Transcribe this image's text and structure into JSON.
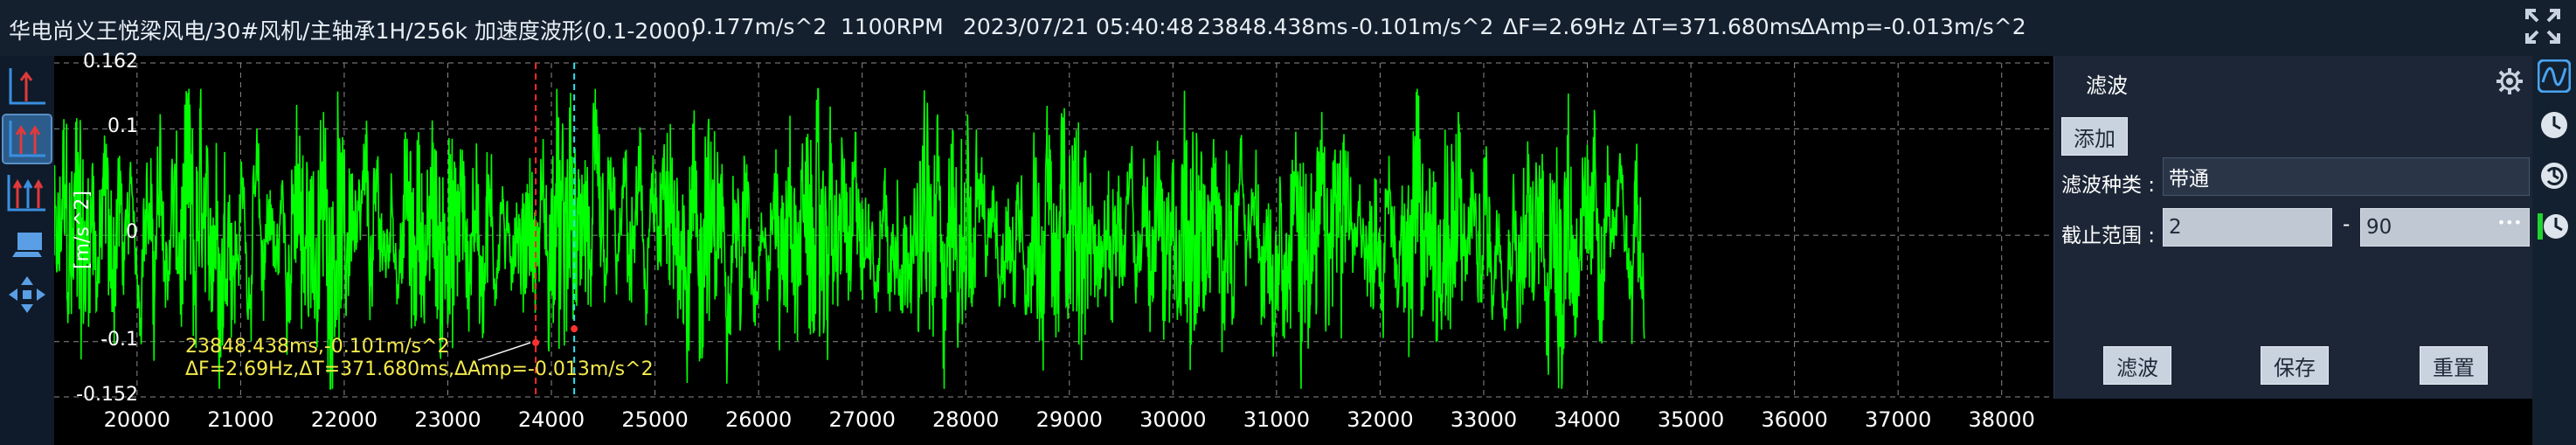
{
  "header": {
    "path": "华电尚义王悦梁风电/30#风机/主轴承1H/256k 加速度波形(0.1-2000)",
    "rms": "0.177m/s^2",
    "speed": "1100RPM",
    "datetime": "2023/07/21 05:40:48",
    "cursor_time": "23848.438ms",
    "cursor_amp": "-0.101m/s^2",
    "delta_f": "ΔF=2.69Hz",
    "delta_t": "ΔT=371.680ms",
    "delta_amp": "ΔAmp=-0.013m/s^2",
    "expand_icon": "expand-icon"
  },
  "toolbar": {
    "items": [
      {
        "icon": "single-cursor-icon"
      },
      {
        "icon": "double-cursor-icon"
      },
      {
        "icon": "multi-cursor-icon"
      },
      {
        "icon": "screenshot-icon"
      },
      {
        "icon": "move-icon"
      }
    ]
  },
  "chart_data": {
    "type": "line",
    "title": "",
    "xlabel": "",
    "ylabel": "[m/s^2]",
    "xlim": [
      19200,
      38500
    ],
    "ylim": [
      -0.152,
      0.162
    ],
    "y_ticks": [
      "0.162",
      "0.1",
      "0",
      "-0.1",
      "-0.152"
    ],
    "x_ticks": [
      "20000",
      "21000",
      "22000",
      "23000",
      "24000",
      "25000",
      "26000",
      "27000",
      "28000",
      "29000",
      "30000",
      "31000",
      "32000",
      "33000",
      "34000",
      "35000",
      "36000",
      "37000",
      "38000"
    ],
    "series": [
      {
        "color": "#00ff00",
        "plotted_range_ms": [
          19200,
          34550
        ]
      }
    ],
    "cursors": [
      {
        "x": 23848.438,
        "y": -0.101,
        "color": "#ff2a2a"
      },
      {
        "x": 24220.118,
        "y": -0.088,
        "color": "#29e3f0"
      }
    ],
    "cursor_label_line1": "23848.438ms,-0.101m/s^2",
    "cursor_label_line2": "ΔF=2.69Hz,ΔT=371.680ms,ΔAmp=-0.013m/s^2",
    "grid": true
  },
  "filter_panel": {
    "title": "滤波",
    "add_label": "添加",
    "type_label": "滤波种类 :",
    "type_value": "带通",
    "range_label": "截止范围 :",
    "range_low": "2",
    "range_sep": "-",
    "range_high": "90",
    "more_glyph": "•••",
    "apply_label": "滤波",
    "save_label": "保存",
    "reset_label": "重置",
    "gear_icon": "gear-icon"
  },
  "right_strip": {
    "items": [
      {
        "icon": "waveform-icon"
      },
      {
        "icon": "history-icon"
      },
      {
        "icon": "history-refresh-icon"
      },
      {
        "icon": "history-alt-icon"
      }
    ]
  },
  "colors": {
    "signal": "#00ff00",
    "cursor1": "#ff2a2a",
    "cursor2": "#29e3f0",
    "label": "#f3e94b",
    "background": "#000000"
  }
}
